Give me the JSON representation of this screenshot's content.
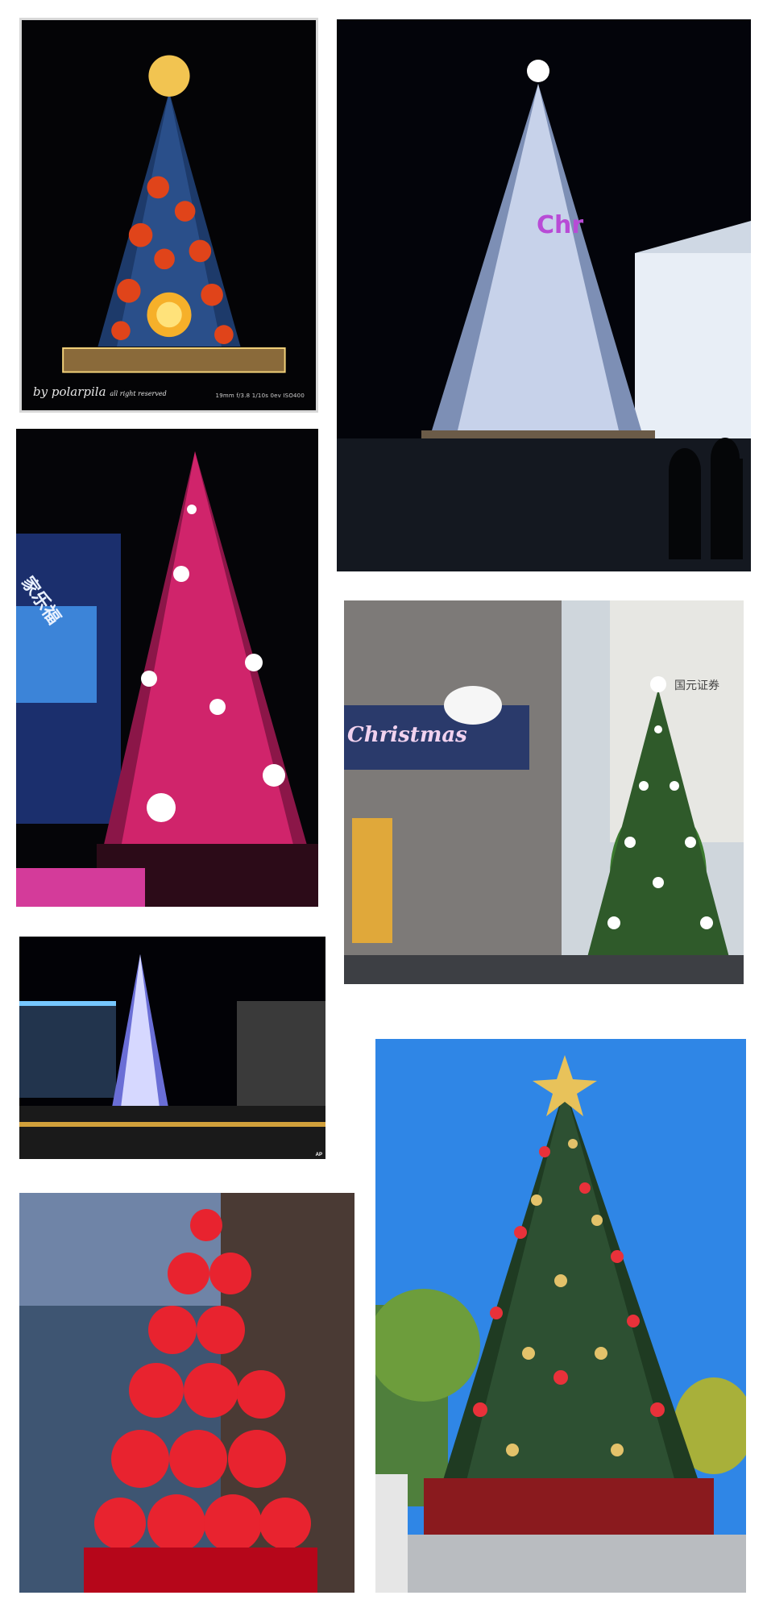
{
  "photos": {
    "p1": {
      "credit": "by polarpila",
      "rights": "all right reserved",
      "exif": "19mm f/3.8 1/10s 0ev ISO400"
    },
    "p2": {
      "sign_text": "Chr"
    },
    "p3": {
      "sign_text": "家乐福"
    },
    "p4": {
      "sign_text": "Christmas",
      "building_sign": "国元证券"
    },
    "p5": {
      "credit": "AP"
    },
    "p6": {},
    "p7": {}
  },
  "colors": {
    "night": "#05060c",
    "pink_tree": "#d0246b",
    "green_tree": "#2f5a2a",
    "sky_blue": "#2f86e6",
    "red_balls": "#e8232f"
  }
}
